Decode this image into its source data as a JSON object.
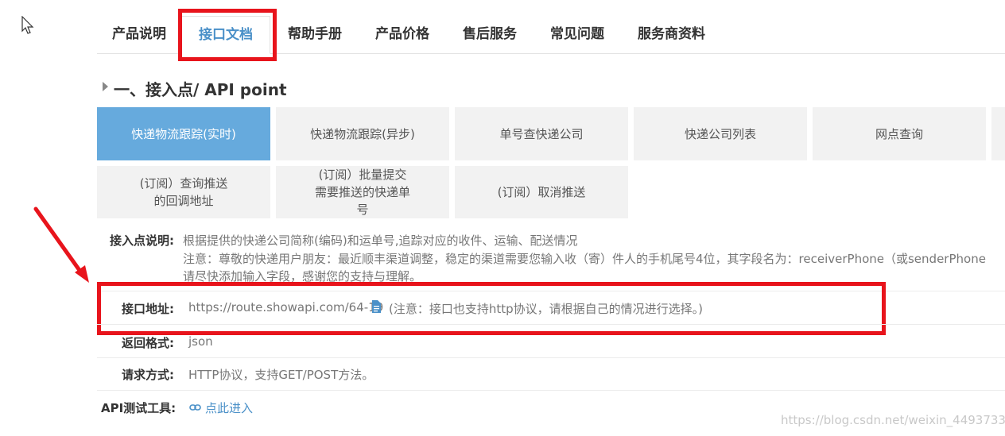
{
  "tabs": [
    {
      "label": "产品说明",
      "active": false
    },
    {
      "label": "接口文档",
      "active": true
    },
    {
      "label": "帮助手册",
      "active": false
    },
    {
      "label": "产品价格",
      "active": false
    },
    {
      "label": "售后服务",
      "active": false
    },
    {
      "label": "常见问题",
      "active": false
    },
    {
      "label": "服务商资料",
      "active": false
    }
  ],
  "section": {
    "title": "一、接入点/ API point"
  },
  "api_buttons": {
    "row1": [
      "快递物流跟踪(实时)",
      "快递物流跟踪(异步)",
      "单号查快递公司",
      "快递公司列表",
      "网点查询"
    ],
    "row2": [
      {
        "line1": "(订阅）查询推送",
        "line2": "的回调地址",
        "line3": ""
      },
      {
        "line1": "(订阅）批量提交",
        "line2": "需要推送的快递单",
        "line3": "号"
      },
      {
        "line1": "(订阅）取消推送",
        "line2": "",
        "line3": ""
      }
    ],
    "active": "快递物流跟踪(实时)"
  },
  "info": {
    "desc_label": "接入点说明:",
    "desc_line1": "根据提供的快递公司简称(编码)和运单号,追踪对应的收件、运输、配送情况",
    "desc_line2": "注意：尊敬的快递用户朋友：最近顺丰渠道调整，稳定的渠道需要您输入收（寄）件人的手机尾号4位，其字段名为：receiverPhone（或senderPhone",
    "desc_line3": "请尽快添加输入字段，感谢您的支持与理解。",
    "url_label": "接口地址:",
    "url_value": "https://route.showapi.com/64-19",
    "url_note": "(注意：接口也支持http协议，请根据自己的情况进行选择。)",
    "format_label": "返回格式:",
    "format_value": "json",
    "method_label": "请求方式:",
    "method_value": "HTTP协议，支持GET/POST方法。",
    "tool_label": "API测试工具:",
    "tool_link": "点此进入"
  },
  "watermark": "https://blog.csdn.net/weixin_44937336",
  "colors": {
    "annotation": "#e8141c",
    "accent": "#4a90c8",
    "active_button": "#66aadd"
  },
  "icons": [
    "cursor-arrow-icon",
    "caret-right-icon",
    "document-icon",
    "link-icon",
    "red-arrow-annotation"
  ]
}
